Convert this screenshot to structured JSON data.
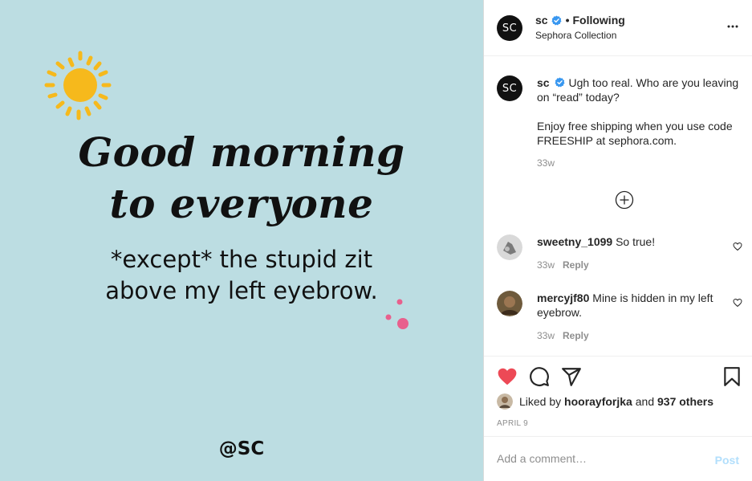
{
  "image": {
    "headline_line1": "Good morning",
    "headline_line2": "to everyone",
    "subline_line1": "*except* the stupid zit",
    "subline_line2": "above my left eyebrow.",
    "handle": "@SC",
    "background_color": "#bcdde2",
    "sun_color": "#f6b91c",
    "dot_color": "#e8608d"
  },
  "header": {
    "avatar_text": "SC",
    "username": "sc",
    "separator": "•",
    "follow_status": "Following",
    "subtitle": "Sephora Collection",
    "more_icon": "more-horizontal-icon"
  },
  "caption": {
    "avatar_text": "SC",
    "username": "sc",
    "text_line1": "Ugh too real. Who are you leaving on “read” today?",
    "text_line2": "Enjoy free shipping when you use code FREESHIP at sephora.com.",
    "time": "33w",
    "load_more_icon": "plus-circle-icon"
  },
  "comments": [
    {
      "username": "sweetny_1099",
      "text": "So true!",
      "time": "33w",
      "reply": "Reply",
      "like_icon": "heart-outline-icon"
    },
    {
      "username": "mercyjf80",
      "text": "Mine is hidden in my left eyebrow.",
      "time": "33w",
      "reply": "Reply",
      "like_icon": "heart-outline-icon"
    }
  ],
  "actions": {
    "like_icon": "heart-filled-icon",
    "comment_icon": "comment-icon",
    "share_icon": "send-icon",
    "save_icon": "bookmark-icon",
    "like_color": "#ed4956"
  },
  "likes": {
    "prefix": "Liked by",
    "user": "hoorayforjka",
    "and": "and",
    "others": "937 others"
  },
  "date": "April 9",
  "comment_box": {
    "placeholder": "Add a comment…",
    "post_label": "Post"
  }
}
